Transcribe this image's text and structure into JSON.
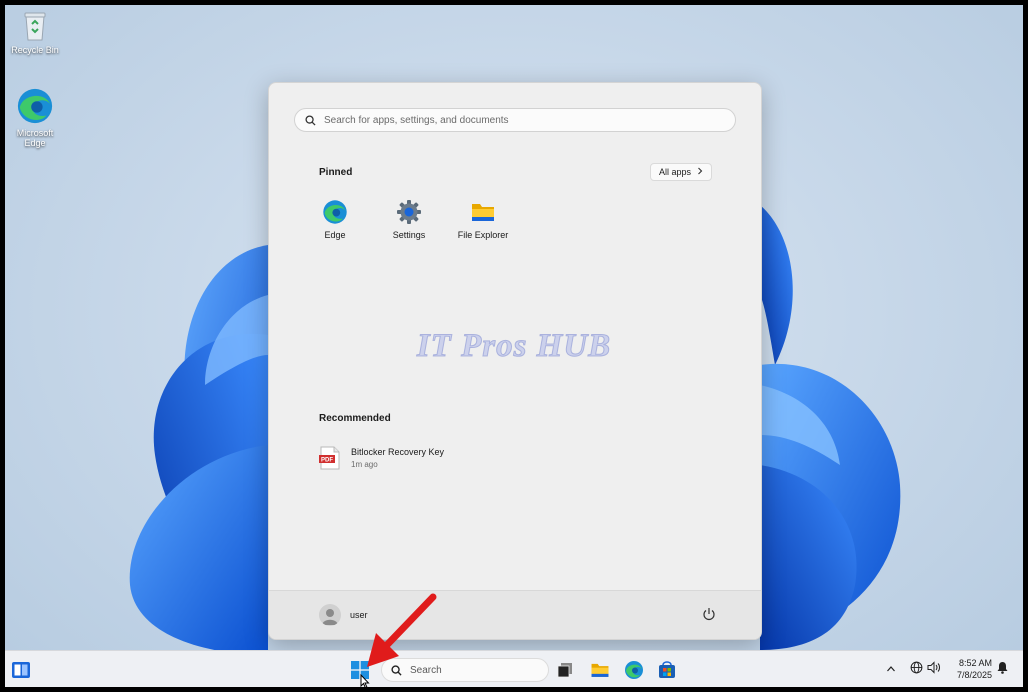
{
  "desktop": {
    "icons": [
      {
        "label": "Recycle Bin",
        "icon": "recycle-bin-icon"
      },
      {
        "label": "Microsoft Edge",
        "icon": "edge-icon"
      }
    ]
  },
  "start_menu": {
    "search_placeholder": "Search for apps, settings, and documents",
    "pinned_title": "Pinned",
    "all_apps_label": "All apps",
    "pinned": [
      {
        "label": "Edge",
        "icon": "edge-icon"
      },
      {
        "label": "Settings",
        "icon": "gear-icon"
      },
      {
        "label": "File Explorer",
        "icon": "folder-icon"
      }
    ],
    "watermark": "IT Pros HUB",
    "recommended_title": "Recommended",
    "recommended": [
      {
        "name": "Bitlocker Recovery Key",
        "time": "1m ago",
        "icon": "pdf-file-icon"
      }
    ],
    "user_name": "user"
  },
  "taskbar": {
    "search_label": "Search",
    "time": "8:52 AM",
    "date": "7/8/2025"
  },
  "colors": {
    "accent_blue": "#1a66d9",
    "arrow_red": "#e01b1b",
    "menu_bg": "#efefef",
    "taskbar_bg": "#eef0f4"
  }
}
